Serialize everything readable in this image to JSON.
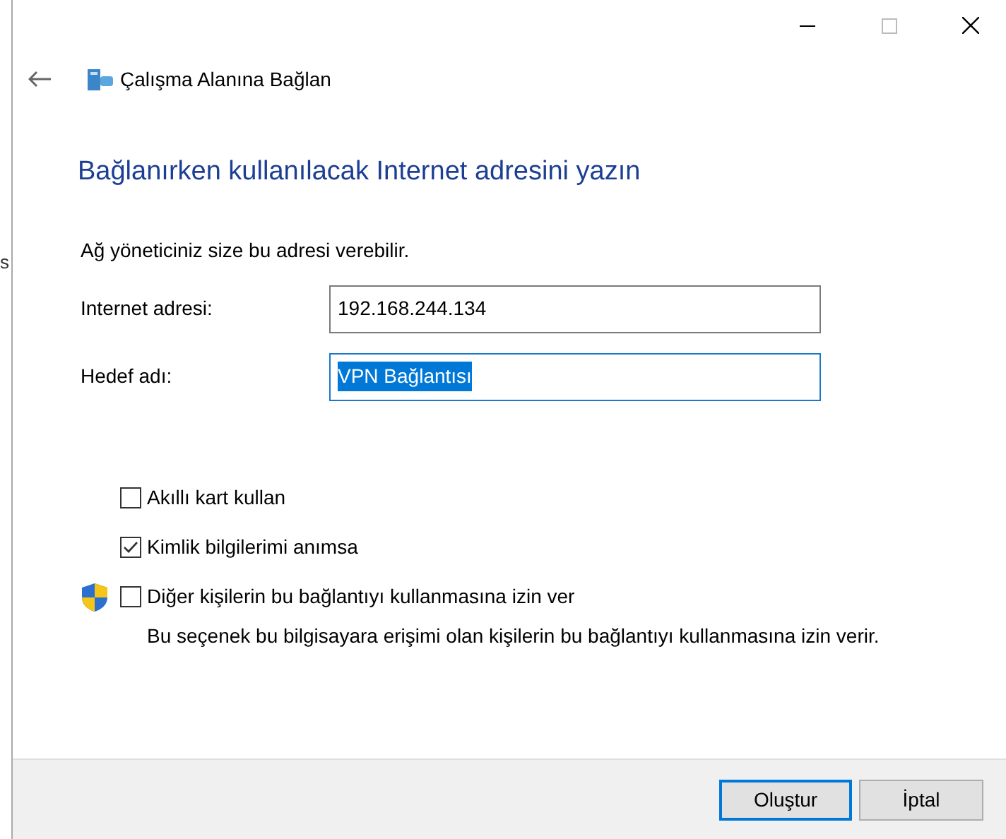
{
  "background_window": {
    "text": "s"
  },
  "window": {
    "title": "Çalışma Alanına Bağlan"
  },
  "heading": "Bağlanırken kullanılacak Internet adresini yazın",
  "intro": "Ağ yöneticiniz size bu adresi verebilir.",
  "fields": [
    {
      "label": "Internet adresi:",
      "value": "192.168.244.134",
      "focused": false
    },
    {
      "label": "Hedef adı:",
      "value": "VPN Bağlantısı",
      "focused": true
    }
  ],
  "options": [
    {
      "label": "Akıllı kart kullan",
      "checked": false,
      "shield": false
    },
    {
      "label": "Kimlik bilgilerimi anımsa",
      "checked": true,
      "shield": false
    },
    {
      "label": "Diğer kişilerin bu bağlantıyı kullanmasına izin ver",
      "checked": false,
      "shield": true,
      "note": "Bu seçenek bu bilgisayara erişimi olan kişilerin bu bağlantıyı kullanmasına izin verir."
    }
  ],
  "buttons": [
    {
      "label": "Oluştur",
      "default": true
    },
    {
      "label": "İptal",
      "default": false
    }
  ]
}
